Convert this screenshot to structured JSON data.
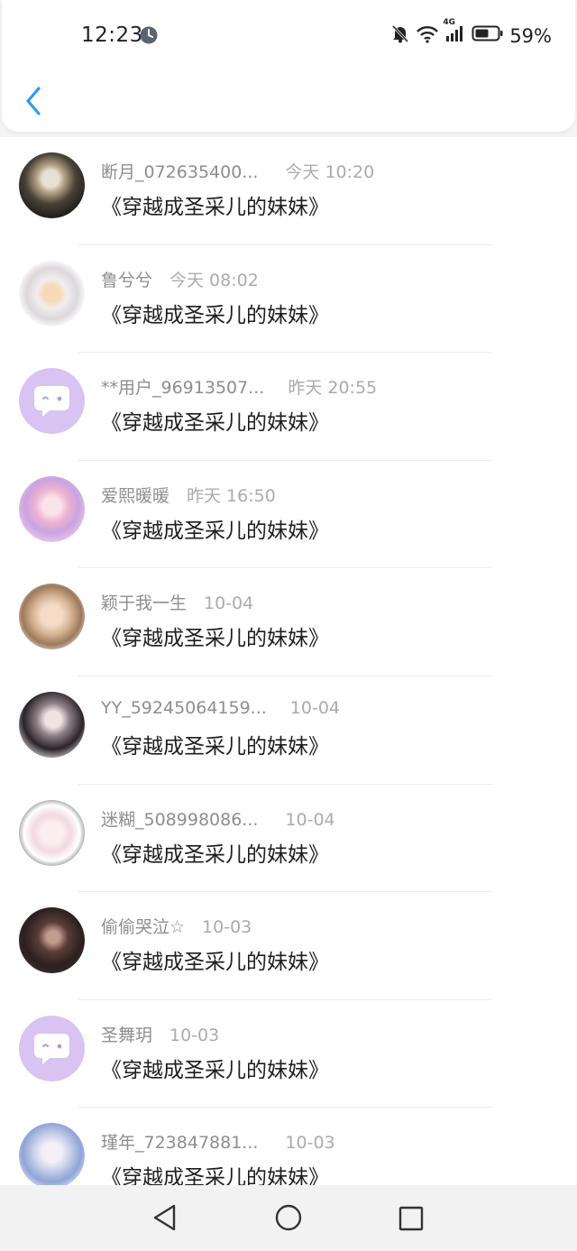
{
  "status_bar": {
    "time": "12:23",
    "battery": "59%",
    "network": "4G"
  },
  "header": {
    "back_icon": "chevron-left-icon"
  },
  "conversations": [
    {
      "name": "断月_072635400...",
      "time": "今天 10:20",
      "message": "《穿越成圣采儿的妹妹》",
      "avatar": "photo"
    },
    {
      "name": "鲁兮兮",
      "time": "今天 08:02",
      "message": "《穿越成圣采儿的妹妹》",
      "avatar": "photo"
    },
    {
      "name": "**用户_96913507...",
      "time": "昨天 20:55",
      "message": "《穿越成圣采儿的妹妹》",
      "avatar": "default-chat-icon"
    },
    {
      "name": "爱熙暖暖",
      "time": "昨天 16:50",
      "message": "《穿越成圣采儿的妹妹》",
      "avatar": "photo"
    },
    {
      "name": "颖于我一生",
      "time": "10-04",
      "message": "《穿越成圣采儿的妹妹》",
      "avatar": "photo"
    },
    {
      "name": "YY_59245064159...",
      "time": "10-04",
      "message": "《穿越成圣采儿的妹妹》",
      "avatar": "photo"
    },
    {
      "name": "迷糊_508998086...",
      "time": "10-04",
      "message": "《穿越成圣采儿的妹妹》",
      "avatar": "photo"
    },
    {
      "name": "偷偷哭泣☆",
      "time": "10-03",
      "message": "《穿越成圣采儿的妹妹》",
      "avatar": "photo"
    },
    {
      "name": "圣舞玥",
      "time": "10-03",
      "message": "《穿越成圣采儿的妹妹》",
      "avatar": "default-chat-icon"
    },
    {
      "name": "瑾年_723847881...",
      "time": "10-03",
      "message": "《穿越成圣采儿的妹妹》",
      "avatar": "photo"
    }
  ],
  "nav_bar": {
    "back": "triangle-back-icon",
    "home": "circle-home-icon",
    "recents": "square-recents-icon"
  },
  "colors": {
    "accent": "#2d9bf0",
    "default_avatar_bg": "#d9c3f2",
    "name_text": "#8e8e8e",
    "time_text": "#ababab"
  }
}
